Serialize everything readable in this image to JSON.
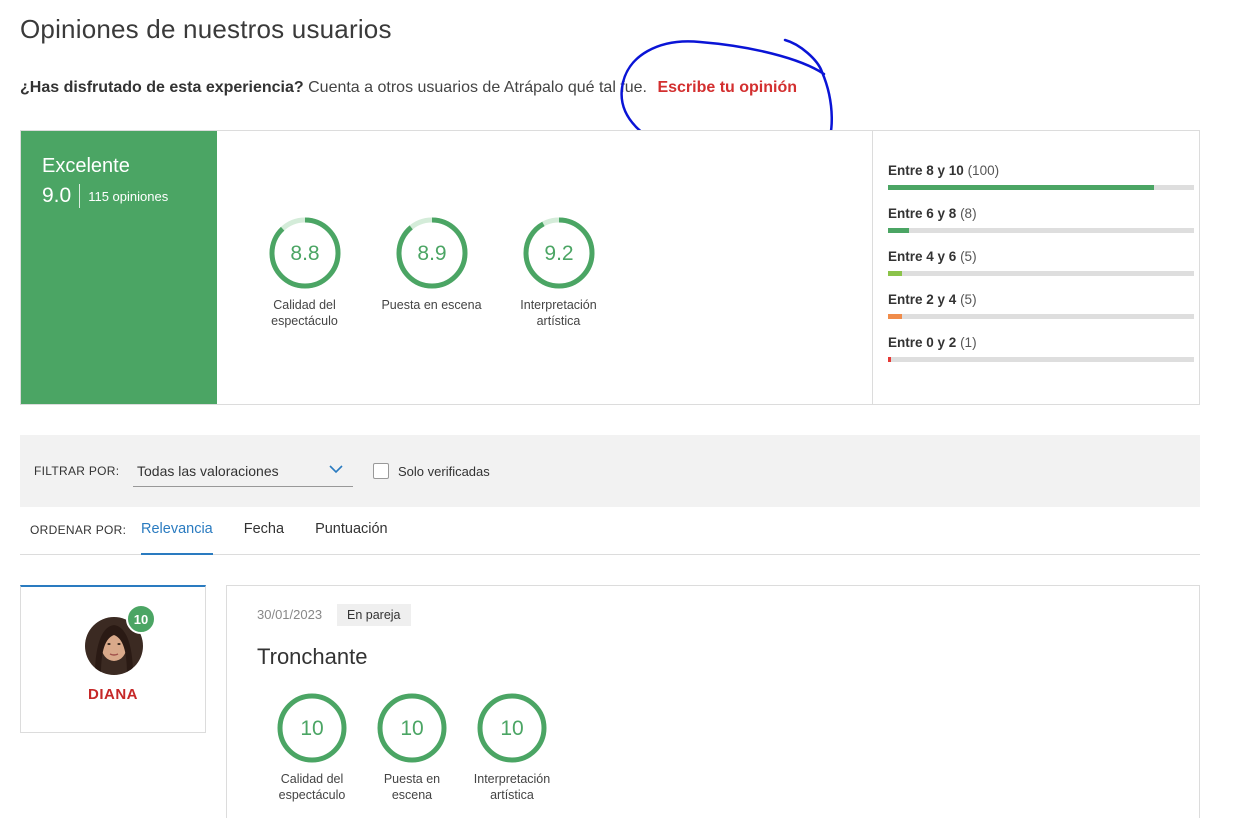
{
  "page": {
    "title": "Opiniones de nuestros usuarios"
  },
  "prompt": {
    "question": "¿Has disfrutado de esta experiencia?",
    "text": "Cuenta a otros usuarios de Atrápalo qué tal fue.",
    "cta": "Escribe tu opinión"
  },
  "summary": {
    "overall_label": "Excelente",
    "overall_score": "9.0",
    "overall_count": "115 opiniones",
    "categories": [
      {
        "score": "8.8",
        "fraction": 0.88,
        "label_line1": "Calidad del",
        "label_line2": "espectáculo"
      },
      {
        "score": "8.9",
        "fraction": 0.89,
        "label_line1": "Puesta en escena",
        "label_line2": ""
      },
      {
        "score": "9.2",
        "fraction": 0.92,
        "label_line1": "Interpretación",
        "label_line2": "artística"
      }
    ],
    "distribution": [
      {
        "range": "Entre 8 y 10",
        "count": "(100)",
        "fraction": 0.87,
        "color": "#4ba564"
      },
      {
        "range": "Entre 6 y 8",
        "count": "(8)",
        "fraction": 0.07,
        "color": "#4ba564"
      },
      {
        "range": "Entre 4 y 6",
        "count": "(5)",
        "fraction": 0.045,
        "color": "#8bc34a"
      },
      {
        "range": "Entre 2 y 4",
        "count": "(5)",
        "fraction": 0.045,
        "color": "#f08c4a"
      },
      {
        "range": "Entre 0 y 2",
        "count": "(1)",
        "fraction": 0.01,
        "color": "#e53935"
      }
    ]
  },
  "filter": {
    "label": "FILTRAR POR:",
    "selected": "Todas las valoraciones",
    "verified_label": "Solo verificadas",
    "verified_checked": false
  },
  "sort": {
    "label": "ORDENAR POR:",
    "tabs": [
      {
        "label": "Relevancia",
        "active": true
      },
      {
        "label": "Fecha",
        "active": false
      },
      {
        "label": "Puntuación",
        "active": false
      }
    ]
  },
  "review": {
    "user_name": "DIANA",
    "user_score": "10",
    "date": "30/01/2023",
    "tag": "En pareja",
    "title": "Tronchante",
    "ratings": [
      {
        "score": "10",
        "fraction": 1.0,
        "label_line1": "Calidad del",
        "label_line2": "espectáculo"
      },
      {
        "score": "10",
        "fraction": 1.0,
        "label_line1": "Puesta en",
        "label_line2": "escena"
      },
      {
        "score": "10",
        "fraction": 1.0,
        "label_line1": "Interpretación",
        "label_line2": "artística"
      }
    ]
  },
  "colors": {
    "green": "#4ba564",
    "ring_track": "#d4ecd9",
    "cta_red": "#d32f2f",
    "accent_blue": "#2a7bc0",
    "annotation_blue": "#0a14d6"
  }
}
